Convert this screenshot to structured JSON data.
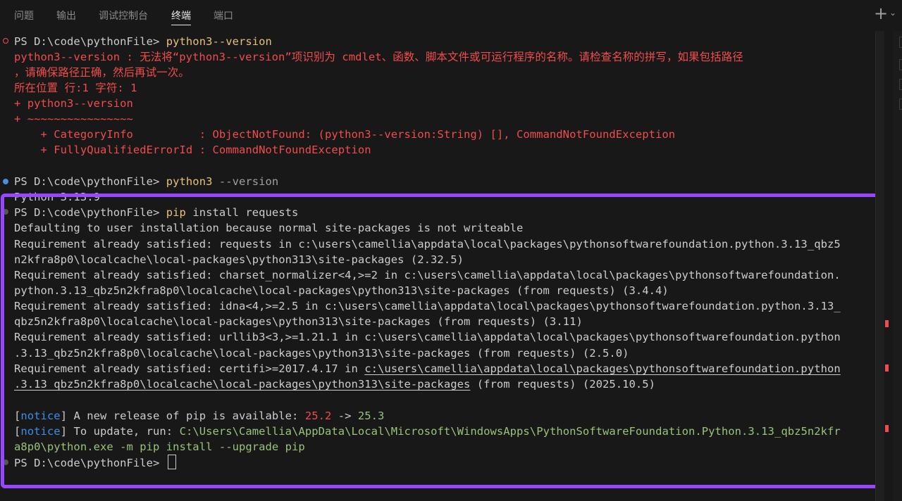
{
  "tabs": [
    {
      "label": "问题"
    },
    {
      "label": "输出"
    },
    {
      "label": "调试控制台"
    },
    {
      "label": "终端"
    },
    {
      "label": "端口"
    }
  ],
  "toolbar": {
    "plus_icon": "plus-icon",
    "chevron_icon": "chevron-down-icon"
  },
  "colors": {
    "highlight": "#9747ff",
    "error": "#f14c4c",
    "command": "#e5c07b",
    "notice": "#3b8eea",
    "green": "#98c379"
  },
  "terminal": {
    "block1": {
      "prompt": "PS D:\\code\\pythonFile> ",
      "cmd": "python3--version",
      "err1": "python3--version : 无法将“python3--version”项识别为 cmdlet、函数、脚本文件或可运行程序的名称。请检查名称的拼写，如果包括路径",
      "err2": "，请确保路径正确，然后再试一次。",
      "err3": "所在位置 行:1 字符: 1",
      "err4": "+ python3--version",
      "err5": "+ ~~~~~~~~~~~~~~~~",
      "err6": "    + CategoryInfo          : ObjectNotFound: (python3--version:String) [], CommandNotFoundException",
      "err7": "    + FullyQualifiedErrorId : CommandNotFoundException"
    },
    "block2": {
      "prompt": "PS D:\\code\\pythonFile> ",
      "cmd": "python3",
      "arg": " --version",
      "output": "Python 3.13.9"
    },
    "block3": {
      "prompt": "PS D:\\code\\pythonFile> ",
      "cmd": "pip",
      "arg": " install requests",
      "l1": "Defaulting to user installation because normal site-packages is not writeable",
      "l2": "Requirement already satisfied: requests in c:\\users\\camellia\\appdata\\local\\packages\\pythonsoftwarefoundation.python.3.13_qbz5",
      "l3": "n2kfra8p0\\localcache\\local-packages\\python313\\site-packages (2.32.5)",
      "l4": "Requirement already satisfied: charset_normalizer<4,>=2 in c:\\users\\camellia\\appdata\\local\\packages\\pythonsoftwarefoundation.",
      "l5": "python.3.13_qbz5n2kfra8p0\\localcache\\local-packages\\python313\\site-packages (from requests) (3.4.4)",
      "l6": "Requirement already satisfied: idna<4,>=2.5 in c:\\users\\camellia\\appdata\\local\\packages\\pythonsoftwarefoundation.python.3.13_",
      "l7": "qbz5n2kfra8p0\\localcache\\local-packages\\python313\\site-packages (from requests) (3.11)",
      "l8": "Requirement already satisfied: urllib3<3,>=1.21.1 in c:\\users\\camellia\\appdata\\local\\packages\\pythonsoftwarefoundation.python",
      "l9": ".3.13_qbz5n2kfra8p0\\localcache\\local-packages\\python313\\site-packages (from requests) (2.5.0)",
      "l10pre": "Requirement already satisfied: certifi>=2017.4.17 in ",
      "l10path": "c:\\users\\camellia\\appdata\\local\\packages\\pythonsoftwarefoundation.python",
      "l11path": ".3.13_qbz5n2kfra8p0\\localcache\\local-packages\\python313\\site-packages",
      "l11post": " (from requests) (2025.10.5)",
      "n1_lb": "[",
      "n1_tag": "notice",
      "n1_rb": "]",
      "n1_text": " A new release of pip is available: ",
      "n1_old": "25.2",
      "n1_arrow": " -> ",
      "n1_new": "25.3",
      "n2_lb": "[",
      "n2_tag": "notice",
      "n2_rb": "]",
      "n2_text": " To update, run: ",
      "n2_cmd1": "C:\\Users\\Camellia\\AppData\\Local\\Microsoft\\WindowsApps\\PythonSoftwareFoundation.Python.3.13_qbz5n2kfr",
      "n2_cmd2": "a8p0\\python.exe -m pip install --upgrade pip",
      "final_prompt": "PS D:\\code\\pythonFile> "
    }
  }
}
